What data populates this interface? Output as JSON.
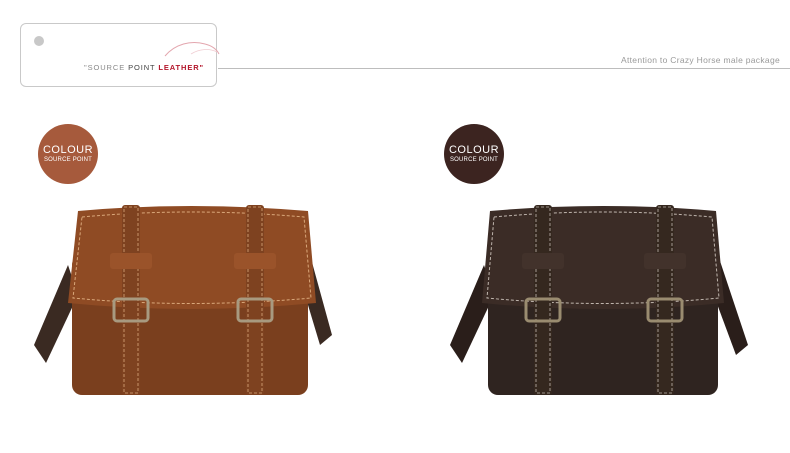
{
  "header": {
    "logo_text_pre": "\"SOURCE",
    "logo_text_mid": "POINT",
    "logo_text_brand": "LEATHER\"",
    "tagline": "Attention to Crazy Horse male package"
  },
  "products": [
    {
      "badge_title": "COLOUR",
      "badge_sub": "SOURCE POINT",
      "badge_color": "#a65a3c",
      "bag_color": "#8a4a22"
    },
    {
      "badge_title": "COLOUR",
      "badge_sub": "SOURCE POINT",
      "badge_color": "#3c2420",
      "bag_color": "#3a2a24"
    }
  ]
}
